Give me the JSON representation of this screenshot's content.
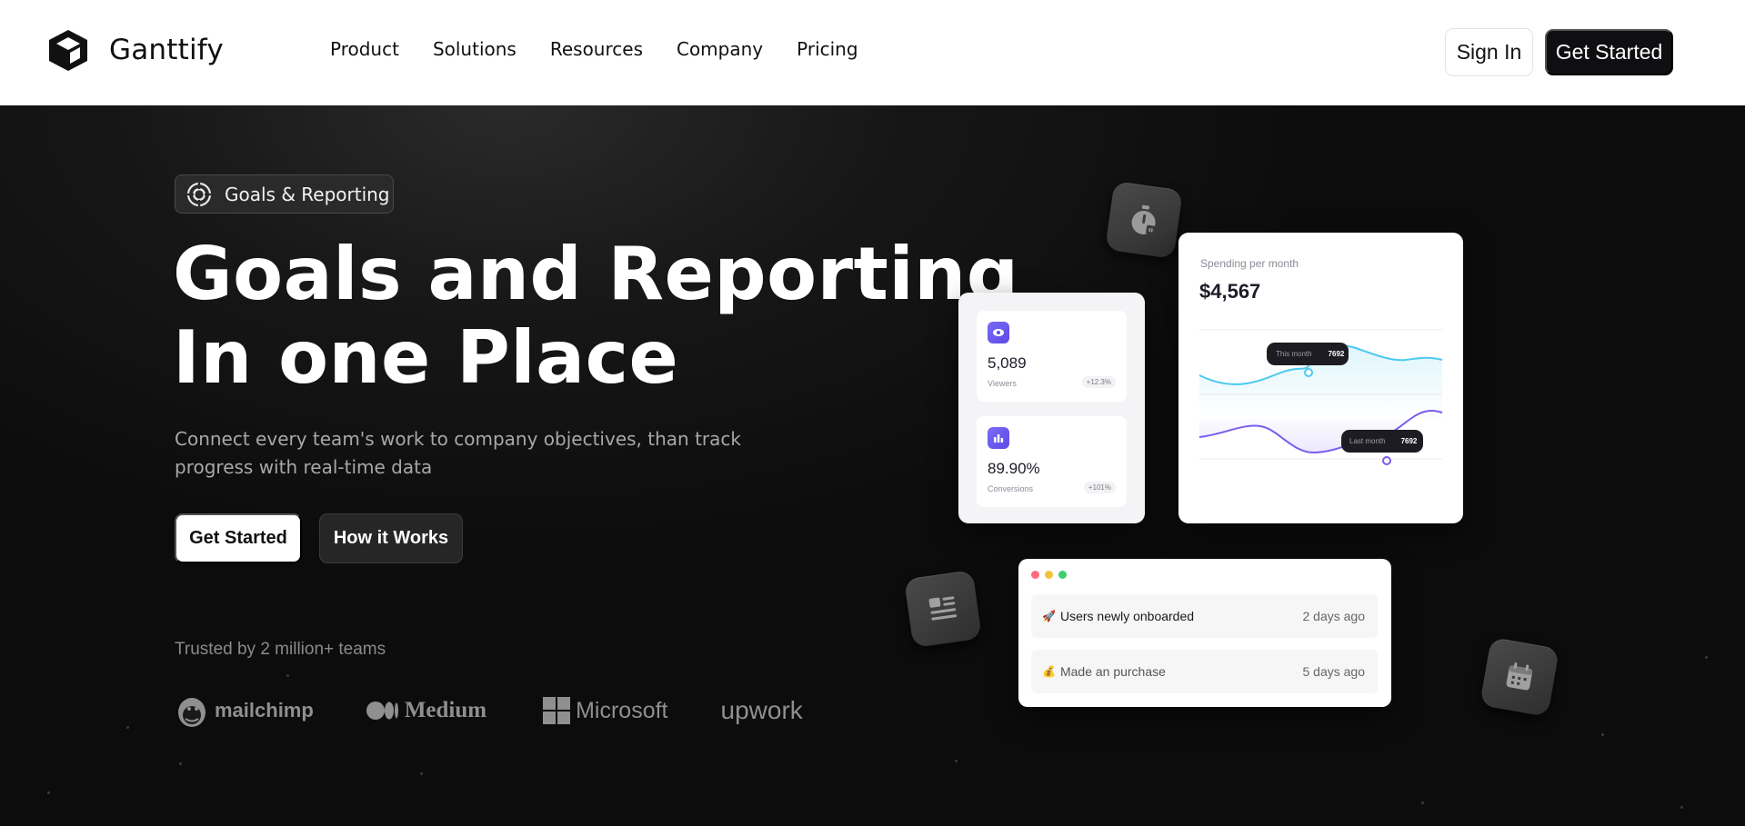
{
  "brand": {
    "name": "Ganttify"
  },
  "nav": {
    "links": [
      "Product",
      "Solutions",
      "Resources",
      "Company",
      "Pricing"
    ],
    "sign_in": "Sign In",
    "get_started": "Get Started"
  },
  "hero": {
    "badge": "Goals & Reporting",
    "headline_line1": "Goals and Reporting",
    "headline_line2": "In one Place",
    "subtext": "Connect every team's work to company objectives, than track progress with real-time data",
    "primary_cta": "Get Started",
    "secondary_cta": "How it Works",
    "trusted": "Trusted by 2 million+ teams",
    "logos": [
      "mailchimp",
      "Medium",
      "Microsoft",
      "upwork"
    ]
  },
  "stats": [
    {
      "value": "5,089",
      "label": "Viewers",
      "change": "+12.3%",
      "icon": "eye-icon"
    },
    {
      "value": "89.90%",
      "label": "Conversions",
      "change": "+101%",
      "icon": "bar-chart-icon"
    }
  ],
  "spending": {
    "title": "Spending per month",
    "value": "$4,567",
    "tooltip_this_month_label": "This month",
    "tooltip_this_month_value": "7692",
    "tooltip_last_month_label": "Last month",
    "tooltip_last_month_value": "7692",
    "colors": {
      "this_month": "#4cc9f0",
      "last_month": "#7b5cf0"
    }
  },
  "activity": {
    "window_dots": [
      "#ff6b7a",
      "#f5c23e",
      "#3ccf6b"
    ],
    "rows": [
      {
        "emoji": "🚀",
        "text": "Users newly onboarded",
        "time": "2 days ago"
      },
      {
        "emoji": "💰",
        "text": "Made an purchase",
        "time": "5 days ago"
      }
    ]
  },
  "floating_icons": [
    "stopwatch-icon",
    "document-icon",
    "calendar-icon"
  ]
}
